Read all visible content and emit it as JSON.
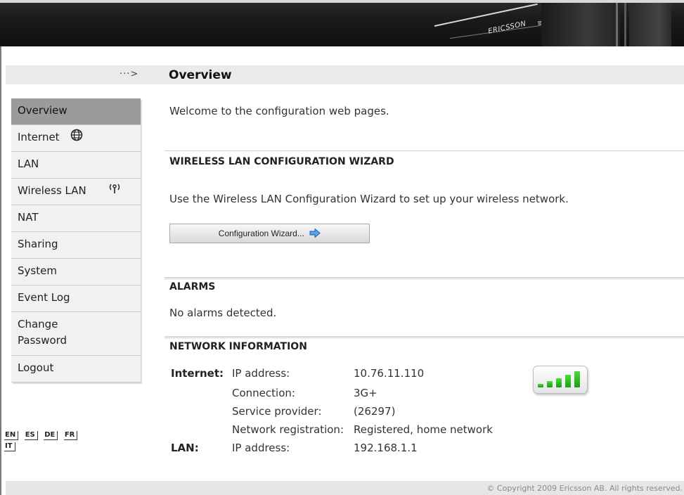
{
  "header": {
    "logo_text": "ERICSSON",
    "logo_mark": "≡"
  },
  "title_strip": {
    "arrow": "···>",
    "page_title": "Overview"
  },
  "sidebar": {
    "items": [
      {
        "label": "Overview",
        "icon": ""
      },
      {
        "label": "Internet",
        "icon": "globe-icon",
        "glyph": "🌐"
      },
      {
        "label": "LAN",
        "icon": ""
      },
      {
        "label": "Wireless LAN",
        "icon": "antenna-icon",
        "glyph": "⁽ᵠ⁾"
      },
      {
        "label": "NAT",
        "icon": ""
      },
      {
        "label": "Sharing",
        "icon": ""
      },
      {
        "label": "System",
        "icon": ""
      },
      {
        "label": "Event Log",
        "icon": ""
      },
      {
        "label": "Change Password",
        "line1": "Change",
        "line2": "Password",
        "icon": ""
      },
      {
        "label": "Logout",
        "icon": ""
      }
    ],
    "active": "Overview"
  },
  "languages": [
    "EN",
    "ES",
    "DE",
    "FR",
    "IT"
  ],
  "main": {
    "welcome": "Welcome to the configuration web pages.",
    "wizard": {
      "title": "WIRELESS LAN CONFIGURATION WIZARD",
      "description": "Use the Wireless LAN Configuration Wizard to set up your wireless network.",
      "button_label": "Configuration Wizard...",
      "button_icon": "➡"
    },
    "alarms": {
      "title": "ALARMS",
      "text": "No alarms detected."
    },
    "network": {
      "title": "NETWORK INFORMATION",
      "internet_label": "Internet:",
      "lan_label": "LAN:",
      "rows": [
        {
          "key": "IP address:",
          "value": "10.76.11.110"
        },
        {
          "key": "Connection:",
          "value": "3G+"
        },
        {
          "key": "Service provider:",
          "value": "(26297)"
        },
        {
          "key": "Network registration:",
          "value": "Registered, home network"
        }
      ],
      "lan_rows": [
        {
          "key": "IP address:",
          "value": "192.168.1.1"
        }
      ],
      "signal_level": "5/5",
      "signal_color": "#2fbf22"
    }
  },
  "footer": {
    "copyright": "© Copyright 2009 Ericsson AB. All rights reserved."
  }
}
